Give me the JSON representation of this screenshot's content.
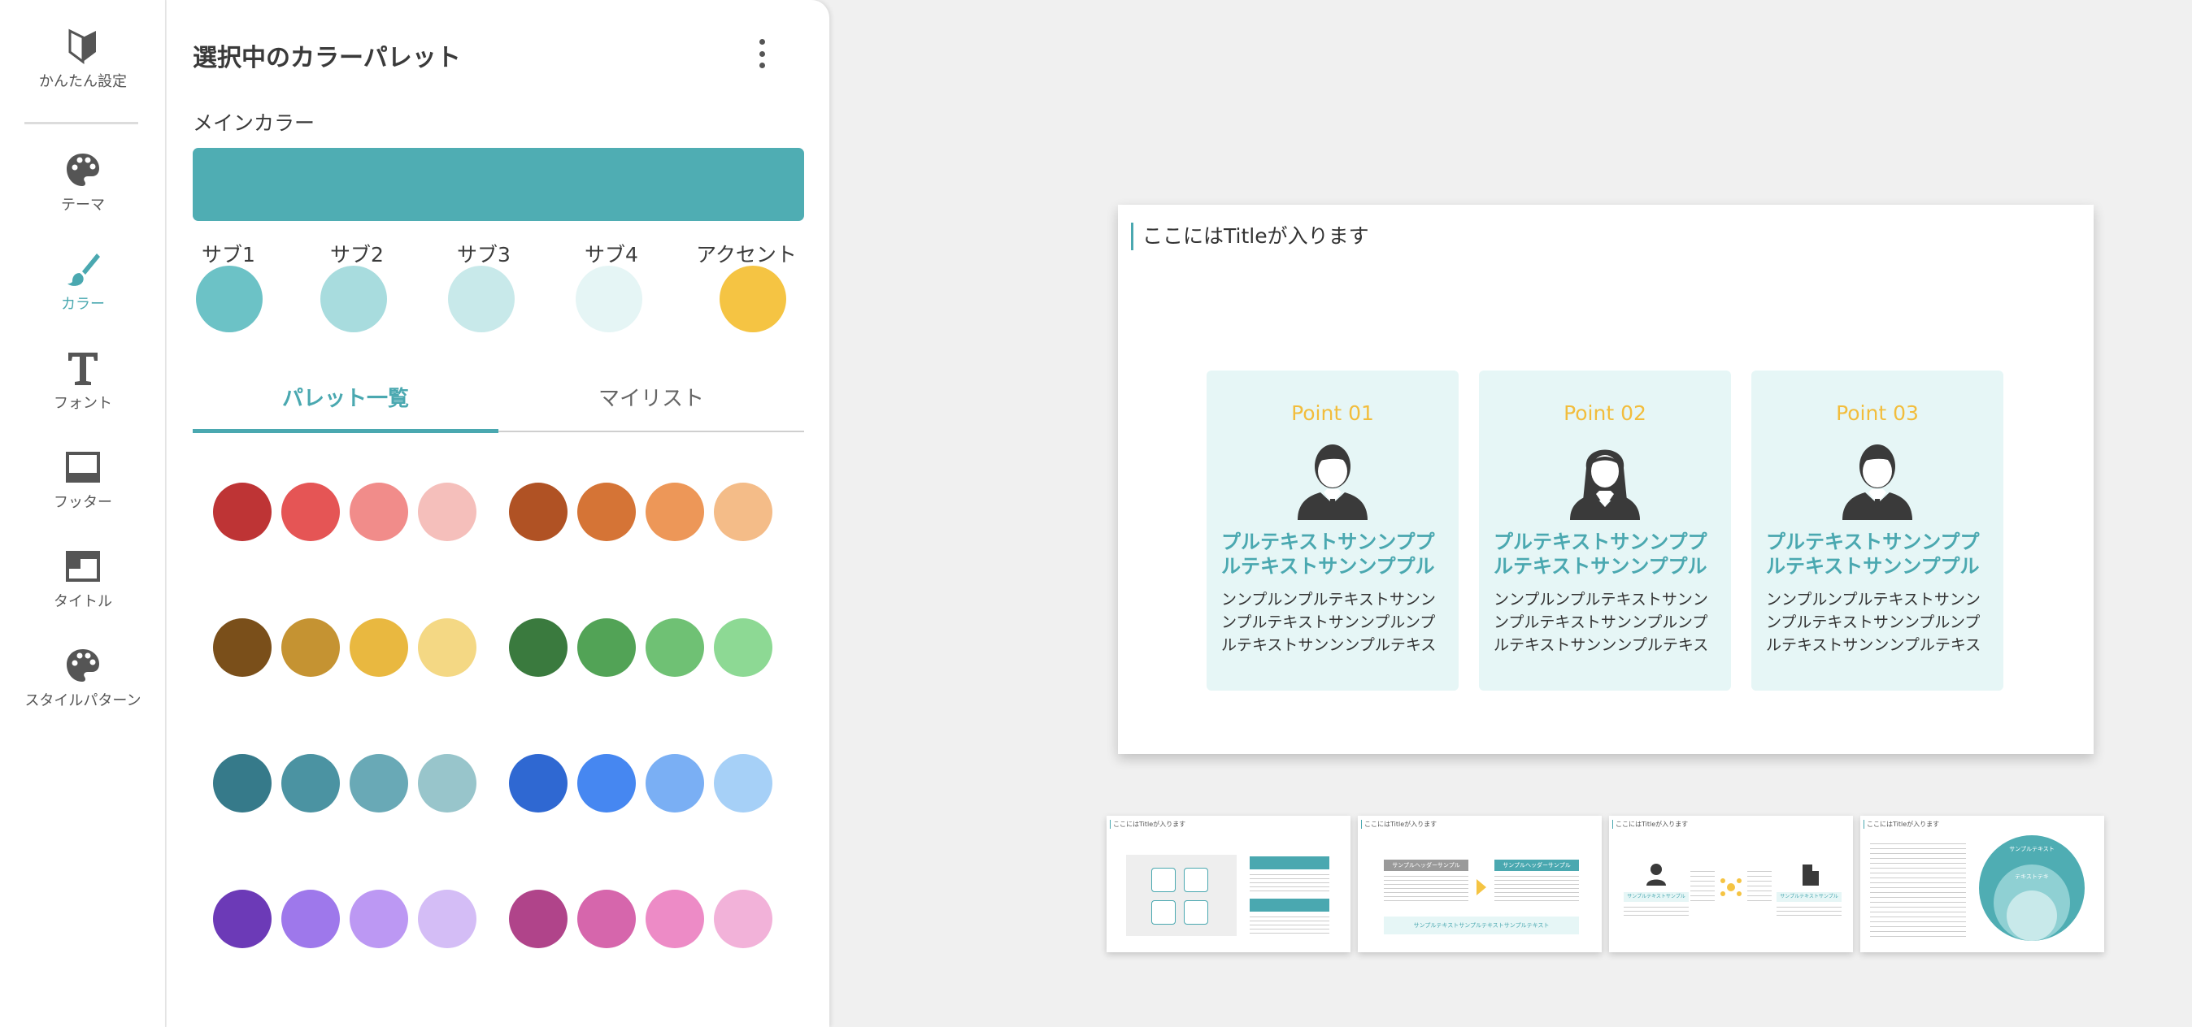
{
  "nav": {
    "items": [
      {
        "label": "かんたん設定",
        "icon": "beginner-mark-icon"
      },
      {
        "label": "テーマ",
        "icon": "palette-icon"
      },
      {
        "label": "カラー",
        "icon": "brush-icon"
      },
      {
        "label": "フォント",
        "icon": "font-icon"
      },
      {
        "label": "フッター",
        "icon": "footer-icon"
      },
      {
        "label": "タイトル",
        "icon": "title-layout-icon"
      },
      {
        "label": "スタイルパターン",
        "icon": "palette-icon"
      }
    ],
    "active_color": "#4aa8b0"
  },
  "panel": {
    "title": "選択中のカラーパレット",
    "main_label": "メインカラー",
    "main_color": "#4fadb3",
    "subs": [
      {
        "label": "サブ1",
        "color": "#6cc2c6"
      },
      {
        "label": "サブ2",
        "color": "#a8dcde"
      },
      {
        "label": "サブ3",
        "color": "#c8e9ea"
      },
      {
        "label": "サブ4",
        "color": "#e5f5f5"
      },
      {
        "label": "アクセント",
        "color": "#f5c443"
      }
    ],
    "tabs": [
      "パレット一覧",
      "マイリスト"
    ],
    "swatch_rows": [
      [
        [
          "#be3435",
          "#e55555",
          "#f18c8a",
          "#f5bfbb"
        ],
        [
          "#b05224",
          "#d57436",
          "#ed9758",
          "#f4bc88"
        ]
      ],
      [
        [
          "#7a4f1a",
          "#c59332",
          "#e9b840",
          "#f4d884"
        ],
        [
          "#3a7a3e",
          "#52a356",
          "#6fc174",
          "#8dd994"
        ]
      ],
      [
        [
          "#367a8a",
          "#4b93a2",
          "#69a9b6",
          "#98c5cb"
        ],
        [
          "#2f68d2",
          "#4687f1",
          "#7aaff4",
          "#a6d0f7"
        ]
      ],
      [
        [
          "#6c3ab7",
          "#9e78eb",
          "#bc98f3",
          "#d4bdf6"
        ],
        [
          "#b0448a",
          "#d666ac",
          "#ed8bc6",
          "#f2b2d9"
        ]
      ]
    ]
  },
  "slide": {
    "title": "ここにはTitleが入ります",
    "cards": [
      {
        "point": "Point 01",
        "heading": "プルテキストサンンププルテキストサンンププルテキ",
        "body": "ンンプルンプルテキストサンンンプルテキストサンンプルンプルテキストサンンンプルテキストサン",
        "person": "male-person-icon"
      },
      {
        "point": "Point 02",
        "heading": "プルテキストサンンププルテキストサンンププルテキ",
        "body": "ンンプルンプルテキストサンンンプルテキストサンンプルンプルテキストサンンンプルテキストサン",
        "person": "female-person-icon"
      },
      {
        "point": "Point 03",
        "heading": "プルテキストサンンププルテキストサンンププルテキ",
        "body": "ンンプルンプルテキストサンンンプルテキストサンンプルンプルテキストサンンンプルテキストサン",
        "person": "male-person-icon"
      }
    ]
  },
  "thumbs": {
    "title": "ここにはTitleが入ります",
    "t2_left": "サンプルヘッダーサンプル",
    "t2_right": "サンプルヘッダーサンプル",
    "t2_bottom": "サンプルテキストサンプルテキストサンプルテキスト",
    "t3_left": "サンプルテキストサンプル",
    "t3_right": "サンプルテキストサンプル",
    "t4_circle_outer": "サンプルテキスト",
    "t4_circle_inner": "テキストテキ"
  }
}
